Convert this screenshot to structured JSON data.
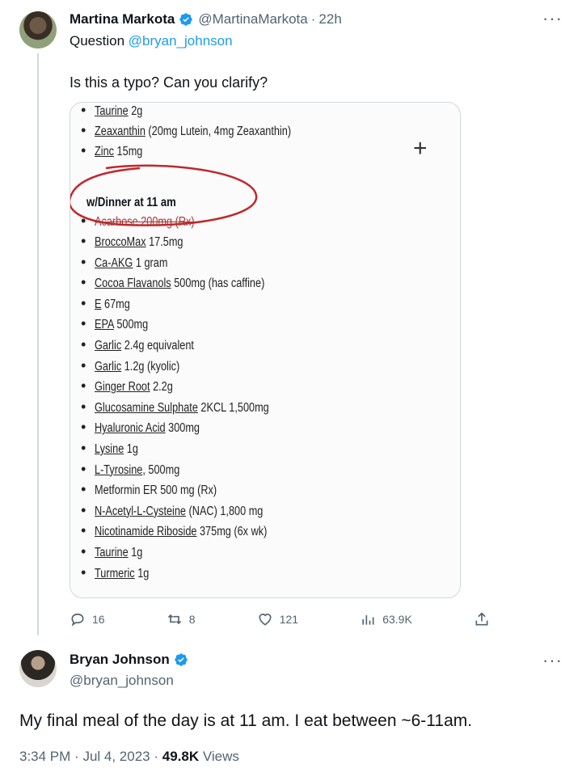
{
  "original_tweet": {
    "author_name": "Martina Markota",
    "author_handle": "@MartinaMarkota",
    "time_ago": "22h",
    "reply_prefix": "Question",
    "reply_mention": "@bryan_johnson",
    "text": "Is this a typo? Can you clarify?",
    "image": {
      "top_items": [
        {
          "u": "Taurine",
          "rest": " 2g"
        },
        {
          "u": "Zeaxanthin",
          "rest": " (20mg Lutein, 4mg Zeaxanthin)"
        },
        {
          "u": "Zinc",
          "rest": " 15mg"
        }
      ],
      "heading": "w/Dinner at 11 am",
      "struck_item": "Acarbose 200mg (Rx)",
      "items": [
        {
          "u": "BroccoMax",
          "rest": " 17.5mg"
        },
        {
          "u": "Ca-AKG",
          "rest": " 1 gram"
        },
        {
          "u": "Cocoa Flavanols",
          "rest": " 500mg (has caffine)"
        },
        {
          "u": "E",
          "rest": " 67mg"
        },
        {
          "u": "EPA",
          "rest": " 500mg"
        },
        {
          "u": "Garlic",
          "rest": " 2.4g equivalent"
        },
        {
          "u": "Garlic",
          "rest": " 1.2g (kyolic)"
        },
        {
          "u": "Ginger Root",
          "rest": " 2.2g"
        },
        {
          "u": "Glucosamine Sulphate",
          "rest": " 2KCL 1,500mg"
        },
        {
          "u": "Hyaluronic Acid",
          "rest": " 300mg"
        },
        {
          "u": "Lysine",
          "rest": " 1g"
        },
        {
          "u": "L-Tyrosine",
          "rest": ", 500mg"
        },
        {
          "u": "",
          "rest": "Metformin ER 500 mg (Rx)"
        },
        {
          "u": "N-Acetyl-L-Cysteine",
          "rest": " (NAC) 1,800 mg"
        },
        {
          "u": "Nicotinamide Riboside",
          "rest": " 375mg (6x wk)"
        },
        {
          "u": "Taurine",
          "rest": " 1g"
        },
        {
          "u": "Turmeric",
          "rest": " 1g"
        }
      ]
    },
    "stats": {
      "replies": "16",
      "retweets": "8",
      "likes": "121",
      "views": "63.9K"
    }
  },
  "reply_tweet": {
    "author_name": "Bryan Johnson",
    "author_handle": "@bryan_johnson",
    "text": "My final meal of the day is at 11 am. I eat between ~6-11am.",
    "time": "3:34 PM",
    "date": "Jul 4, 2023",
    "views_count": "49.8K",
    "views_label": "Views"
  },
  "colors": {
    "link": "#1d9bf0",
    "secondary_text": "#536471",
    "annotation_red": "#c0282d"
  }
}
